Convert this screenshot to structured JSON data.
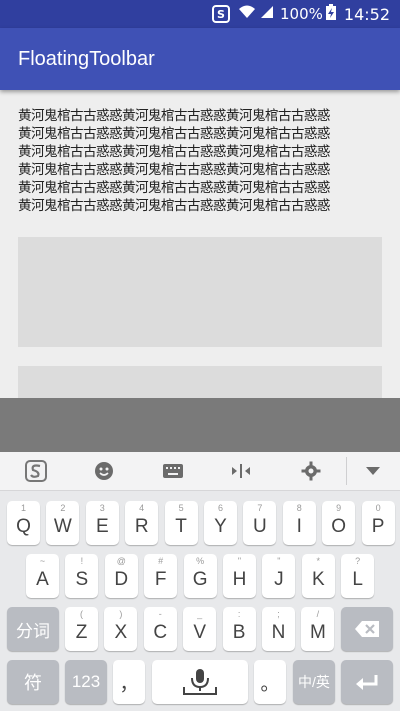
{
  "status": {
    "battery": "100%",
    "time": "14:52",
    "app_badge": "S"
  },
  "app": {
    "title": "FloatingToolbar"
  },
  "content": {
    "lines": [
      "黄河鬼棺古古惑惑黄河鬼棺古古惑惑黄河鬼棺古古惑惑",
      "黄河鬼棺古古惑惑黄河鬼棺古古惑惑黄河鬼棺古古惑惑",
      "黄河鬼棺古古惑惑黄河鬼棺古古惑惑黄河鬼棺古古惑惑",
      "黄河鬼棺古古惑惑黄河鬼棺古古惑惑黄河鬼棺古古惑惑",
      "黄河鬼棺古古惑惑黄河鬼棺古古惑惑黄河鬼棺古古惑惑",
      "黄河鬼棺古古惑惑黄河鬼棺古古惑惑黄河鬼棺古古惑惑"
    ]
  },
  "keyboard": {
    "toolbar_icons": [
      "sogou-logo-icon",
      "emoji-icon",
      "keyboard-icon",
      "cursor-move-icon",
      "settings-gear-icon",
      "collapse-triangle-icon"
    ],
    "row1": [
      {
        "main": "Q",
        "hint": "1"
      },
      {
        "main": "W",
        "hint": "2"
      },
      {
        "main": "E",
        "hint": "3"
      },
      {
        "main": "R",
        "hint": "4"
      },
      {
        "main": "T",
        "hint": "5"
      },
      {
        "main": "Y",
        "hint": "6"
      },
      {
        "main": "U",
        "hint": "7"
      },
      {
        "main": "I",
        "hint": "8"
      },
      {
        "main": "O",
        "hint": "9"
      },
      {
        "main": "P",
        "hint": "0"
      }
    ],
    "row2": [
      {
        "main": "A",
        "hint": "~"
      },
      {
        "main": "S",
        "hint": "!"
      },
      {
        "main": "D",
        "hint": "@"
      },
      {
        "main": "F",
        "hint": "#"
      },
      {
        "main": "G",
        "hint": "%"
      },
      {
        "main": "H",
        "hint": "\""
      },
      {
        "main": "J",
        "hint": "\""
      },
      {
        "main": "K",
        "hint": "*"
      },
      {
        "main": "L",
        "hint": "?"
      }
    ],
    "row3": [
      {
        "main": "Z",
        "hint": "("
      },
      {
        "main": "X",
        "hint": ")"
      },
      {
        "main": "C",
        "hint": "-"
      },
      {
        "main": "V",
        "hint": "_"
      },
      {
        "main": "B",
        "hint": ":"
      },
      {
        "main": "N",
        "hint": ";"
      },
      {
        "main": "M",
        "hint": "/"
      }
    ],
    "fenci": "分词",
    "fu": "符",
    "num": "123",
    "comma": "，",
    "period": "。",
    "zhong_ying": "中/英"
  }
}
